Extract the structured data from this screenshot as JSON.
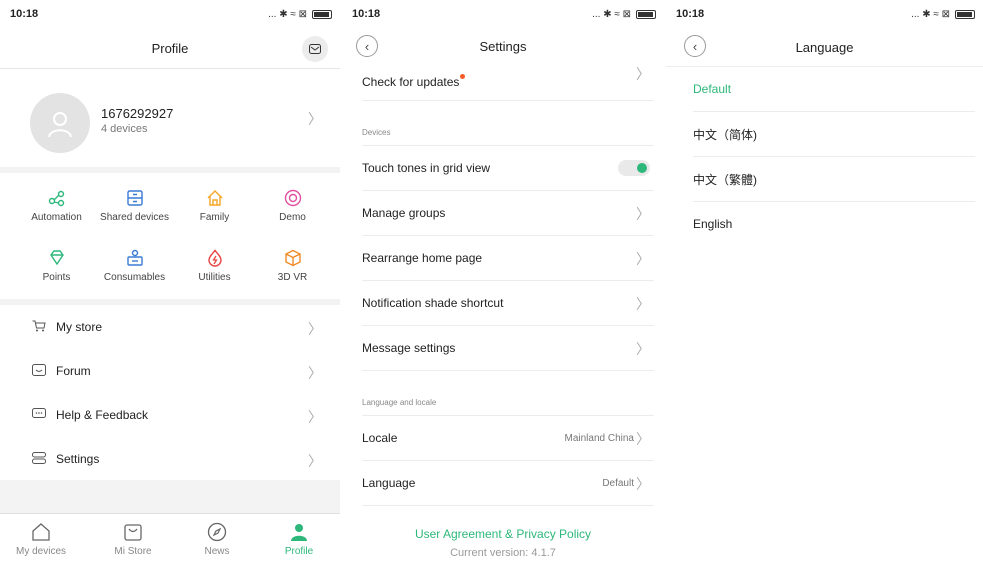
{
  "status": {
    "time": "10:18",
    "icons": "... ✱ ≈ ⊠"
  },
  "profile": {
    "title": "Profile",
    "user_id": "1676292927",
    "devices": "4 devices",
    "grid": [
      {
        "label": "Automation",
        "icon": "automation-icon",
        "color": "#2db77a"
      },
      {
        "label": "Shared devices",
        "icon": "shared-devices-icon",
        "color": "#3a7bd5"
      },
      {
        "label": "Family",
        "icon": "family-icon",
        "color": "#f5a623"
      },
      {
        "label": "Demo",
        "icon": "demo-icon",
        "color": "#e04fa0"
      },
      {
        "label": "Points",
        "icon": "points-icon",
        "color": "#2db77a"
      },
      {
        "label": "Consumables",
        "icon": "consumables-icon",
        "color": "#3a7bd5"
      },
      {
        "label": "Utilities",
        "icon": "utilities-icon",
        "color": "#e84545"
      },
      {
        "label": "3D VR",
        "icon": "vr-icon",
        "color": "#f08a24"
      }
    ],
    "menu": [
      {
        "label": "My store",
        "icon": "cart-icon"
      },
      {
        "label": "Forum",
        "icon": "forum-icon"
      },
      {
        "label": "Help & Feedback",
        "icon": "feedback-icon"
      },
      {
        "label": "Settings",
        "icon": "settings-icon"
      }
    ],
    "tabs": [
      {
        "label": "My devices",
        "icon": "home-icon"
      },
      {
        "label": "Mi Store",
        "icon": "store-icon"
      },
      {
        "label": "News",
        "icon": "compass-icon"
      },
      {
        "label": "Profile",
        "icon": "person-icon"
      }
    ]
  },
  "settings": {
    "title": "Settings",
    "check_updates": "Check for updates",
    "section_devices": "Devices",
    "touch_tones": "Touch tones in grid view",
    "touch_tones_on": true,
    "manage_groups": "Manage groups",
    "rearrange": "Rearrange home page",
    "notification": "Notification shade shortcut",
    "message": "Message settings",
    "section_lang": "Language and locale",
    "locale": "Locale",
    "locale_value": "Mainland China",
    "language": "Language",
    "language_value": "Default",
    "agreement": "User Agreement & Privacy Policy",
    "version": "Current version: 4.1.7"
  },
  "language": {
    "title": "Language",
    "options": [
      "Default",
      "中文（简体)",
      "中文（繁體)",
      "English"
    ]
  },
  "accent": "#2db77a"
}
